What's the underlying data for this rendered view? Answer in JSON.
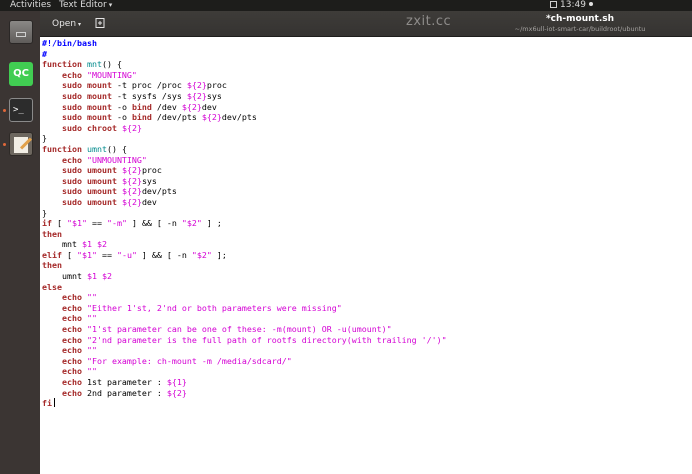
{
  "topbar": {
    "activities": "Activities",
    "app_menu": "Text Editor",
    "clock": "13:49"
  },
  "launcher": {
    "items": [
      {
        "name": "files",
        "icon": "files-icon"
      },
      {
        "name": "qt-creator",
        "icon": "qt-creator-icon",
        "label": "QC"
      },
      {
        "name": "terminal",
        "icon": "terminal-icon",
        "label": ">_"
      },
      {
        "name": "text-editor",
        "icon": "text-editor-icon"
      }
    ]
  },
  "header": {
    "open_label": "Open",
    "watermark": "zxit.cc",
    "title": "*ch-mount.sh",
    "path": "~/mx6ull-iot-smart-car/buildroot/ubuntu"
  },
  "editor": {
    "lines": [
      "#!/bin/bash",
      "#",
      "function mnt() {",
      "    echo \"MOUNTING\"",
      "    sudo mount -t proc /proc ${2}proc",
      "    sudo mount -t sysfs /sys ${2}sys",
      "    sudo mount -o bind /dev ${2}dev",
      "    sudo mount -o bind /dev/pts ${2}dev/pts",
      "    sudo chroot ${2}",
      "}",
      "function umnt() {",
      "    echo \"UNMOUNTING\"",
      "    sudo umount ${2}proc",
      "    sudo umount ${2}sys",
      "    sudo umount ${2}dev/pts",
      "    sudo umount ${2}dev",
      "}",
      "if [ \"$1\" == \"-m\" ] && [ -n \"$2\" ] ;",
      "then",
      "    mnt $1 $2",
      "elif [ \"$1\" == \"-u\" ] && [ -n \"$2\" ];",
      "then",
      "    umnt $1 $2",
      "else",
      "    echo \"\"",
      "    echo \"Either 1'st, 2'nd or both parameters were missing\"",
      "    echo \"\"",
      "    echo \"1'st parameter can be one of these: -m(mount) OR -u(umount)\"",
      "    echo \"2'nd parameter is the full path of rootfs directory(with trailing '/')\"",
      "    echo \"\"",
      "    echo \"For example: ch-mount -m /media/sdcard/\"",
      "    echo \"\"",
      "    echo 1st parameter : ${1}",
      "    echo 2nd parameter : ${2}",
      "fi"
    ]
  }
}
